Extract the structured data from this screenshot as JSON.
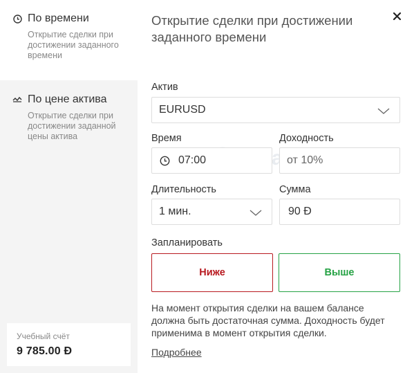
{
  "sidebar": {
    "modes": [
      {
        "title": "По времени",
        "description": "Открытие сделки при достижении заданного времени",
        "icon": "clock-icon",
        "active": true
      },
      {
        "title": "По цене актива",
        "description": "Открытие сделки при достижении заданной цены актива",
        "icon": "price-chart-icon",
        "active": false
      }
    ],
    "account": {
      "label": "Учебный счёт",
      "balance": "9 785.00 Đ"
    }
  },
  "main": {
    "heading": "Открытие сделки при достижении заданного времени",
    "asset": {
      "label": "Актив",
      "value": "EURUSD"
    },
    "time": {
      "label": "Время",
      "value": "07:00"
    },
    "profit": {
      "label": "Доходность",
      "value": "от 10%"
    },
    "duration": {
      "label": "Длительность",
      "value": "1 мин."
    },
    "amount": {
      "label": "Сумма",
      "value": "90 Đ"
    },
    "schedule": {
      "label": "Запланировать",
      "lower": "Ниже",
      "higher": "Выше"
    },
    "note": "На момент открытия сделки на вашем балансе должна быть достаточная сумма. Доходность будет применима в момент открытия сделки.",
    "more_link": "Подробнее"
  },
  "watermark": "Binarynow",
  "colors": {
    "lower": "#b8191f",
    "higher": "#25a244",
    "sidebar_bg": "#f4f4f4"
  }
}
